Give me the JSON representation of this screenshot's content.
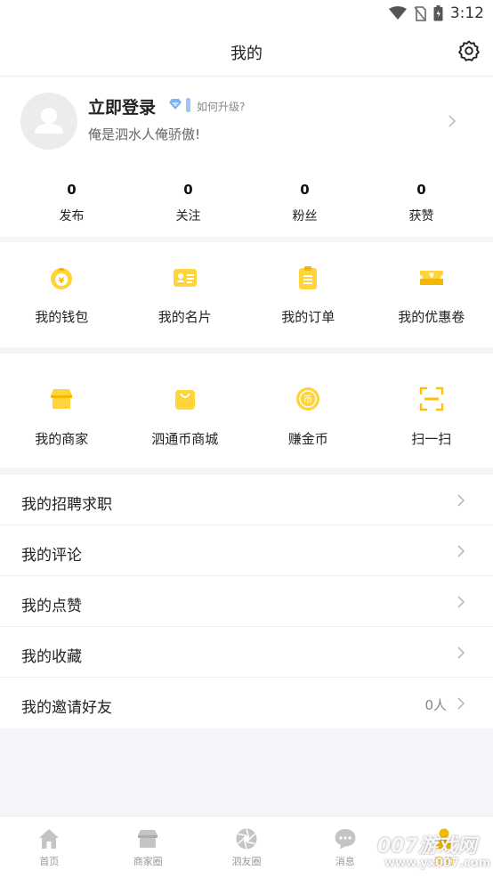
{
  "status_bar": {
    "time": "3:12"
  },
  "header": {
    "title": "我的"
  },
  "profile": {
    "login_label": "立即登录",
    "upgrade_link": "如何升级?",
    "signature": "俺是泗水人俺骄傲!"
  },
  "stats": [
    {
      "value": "0",
      "label": "发布"
    },
    {
      "value": "0",
      "label": "关注"
    },
    {
      "value": "0",
      "label": "粉丝"
    },
    {
      "value": "0",
      "label": "获赞"
    }
  ],
  "grid_top": [
    {
      "label": "我的钱包",
      "icon": "money-bag-icon"
    },
    {
      "label": "我的名片",
      "icon": "business-card-icon"
    },
    {
      "label": "我的订单",
      "icon": "order-clipboard-icon"
    },
    {
      "label": "我的优惠卷",
      "icon": "coupon-ticket-icon"
    }
  ],
  "grid_bottom": [
    {
      "label": "我的商家",
      "icon": "shop-icon"
    },
    {
      "label": "泗通币商城",
      "icon": "shopping-bag-icon"
    },
    {
      "label": "赚金币",
      "icon": "coin-icon"
    },
    {
      "label": "扫一扫",
      "icon": "scan-icon"
    }
  ],
  "menu": [
    {
      "label": "我的招聘求职",
      "value": ""
    },
    {
      "label": "我的评论",
      "value": ""
    },
    {
      "label": "我的点赞",
      "value": ""
    },
    {
      "label": "我的收藏",
      "value": ""
    },
    {
      "label": "我的邀请好友",
      "value": "0人"
    }
  ],
  "tabbar": [
    {
      "label": "首页",
      "icon": "home-icon"
    },
    {
      "label": "商家圈",
      "icon": "shop-icon"
    },
    {
      "label": "泗友圈",
      "icon": "aperture-icon"
    },
    {
      "label": "消息",
      "icon": "chat-bubble-icon"
    },
    {
      "label": "我的",
      "icon": "person-icon",
      "active": true
    }
  ],
  "watermark": {
    "main": "007游戏网",
    "sub": "www.yx007.com"
  },
  "colors": {
    "accent": "#f5b800",
    "accent_light": "#ffd43b",
    "background": "#f4f5f8",
    "text": "#222222",
    "muted": "#999999"
  }
}
